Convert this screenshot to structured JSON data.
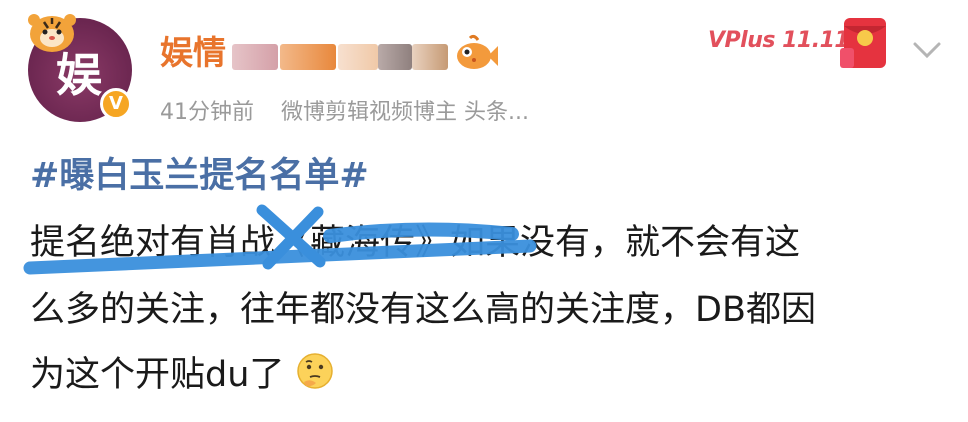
{
  "header": {
    "avatar_glyph": "娱",
    "username": "娱情",
    "meta_time": "41分钟前",
    "meta_desc": "微博剪辑视频博主 头条...",
    "vplus_label": "VPlus 11.11",
    "colors": {
      "username": "#e8742c",
      "hashtag": "#4a6fa5",
      "meta": "#9a9a9a",
      "strike": "#3a8fdc",
      "avatar_bg": "#6b2650",
      "verified": "#f6a623"
    }
  },
  "content": {
    "hashtag": "#曝白玉兰提名名单#",
    "line1_a": "提名绝对有肖战《藏海传》",
    "line1_b": "如果没有，就不会有这",
    "line2": "么多的关注，往年都没有这么高的关注度，DB都因",
    "line3": "为这个开贴du了"
  },
  "icons": {
    "avatar_tiger": "tiger-icon",
    "verified": "verified-badge-icon",
    "fish": "fish-emoji-icon",
    "redpacket": "red-packet-icon",
    "chevron": "chevron-down-icon",
    "thinking": "thinking-face-emoji"
  }
}
